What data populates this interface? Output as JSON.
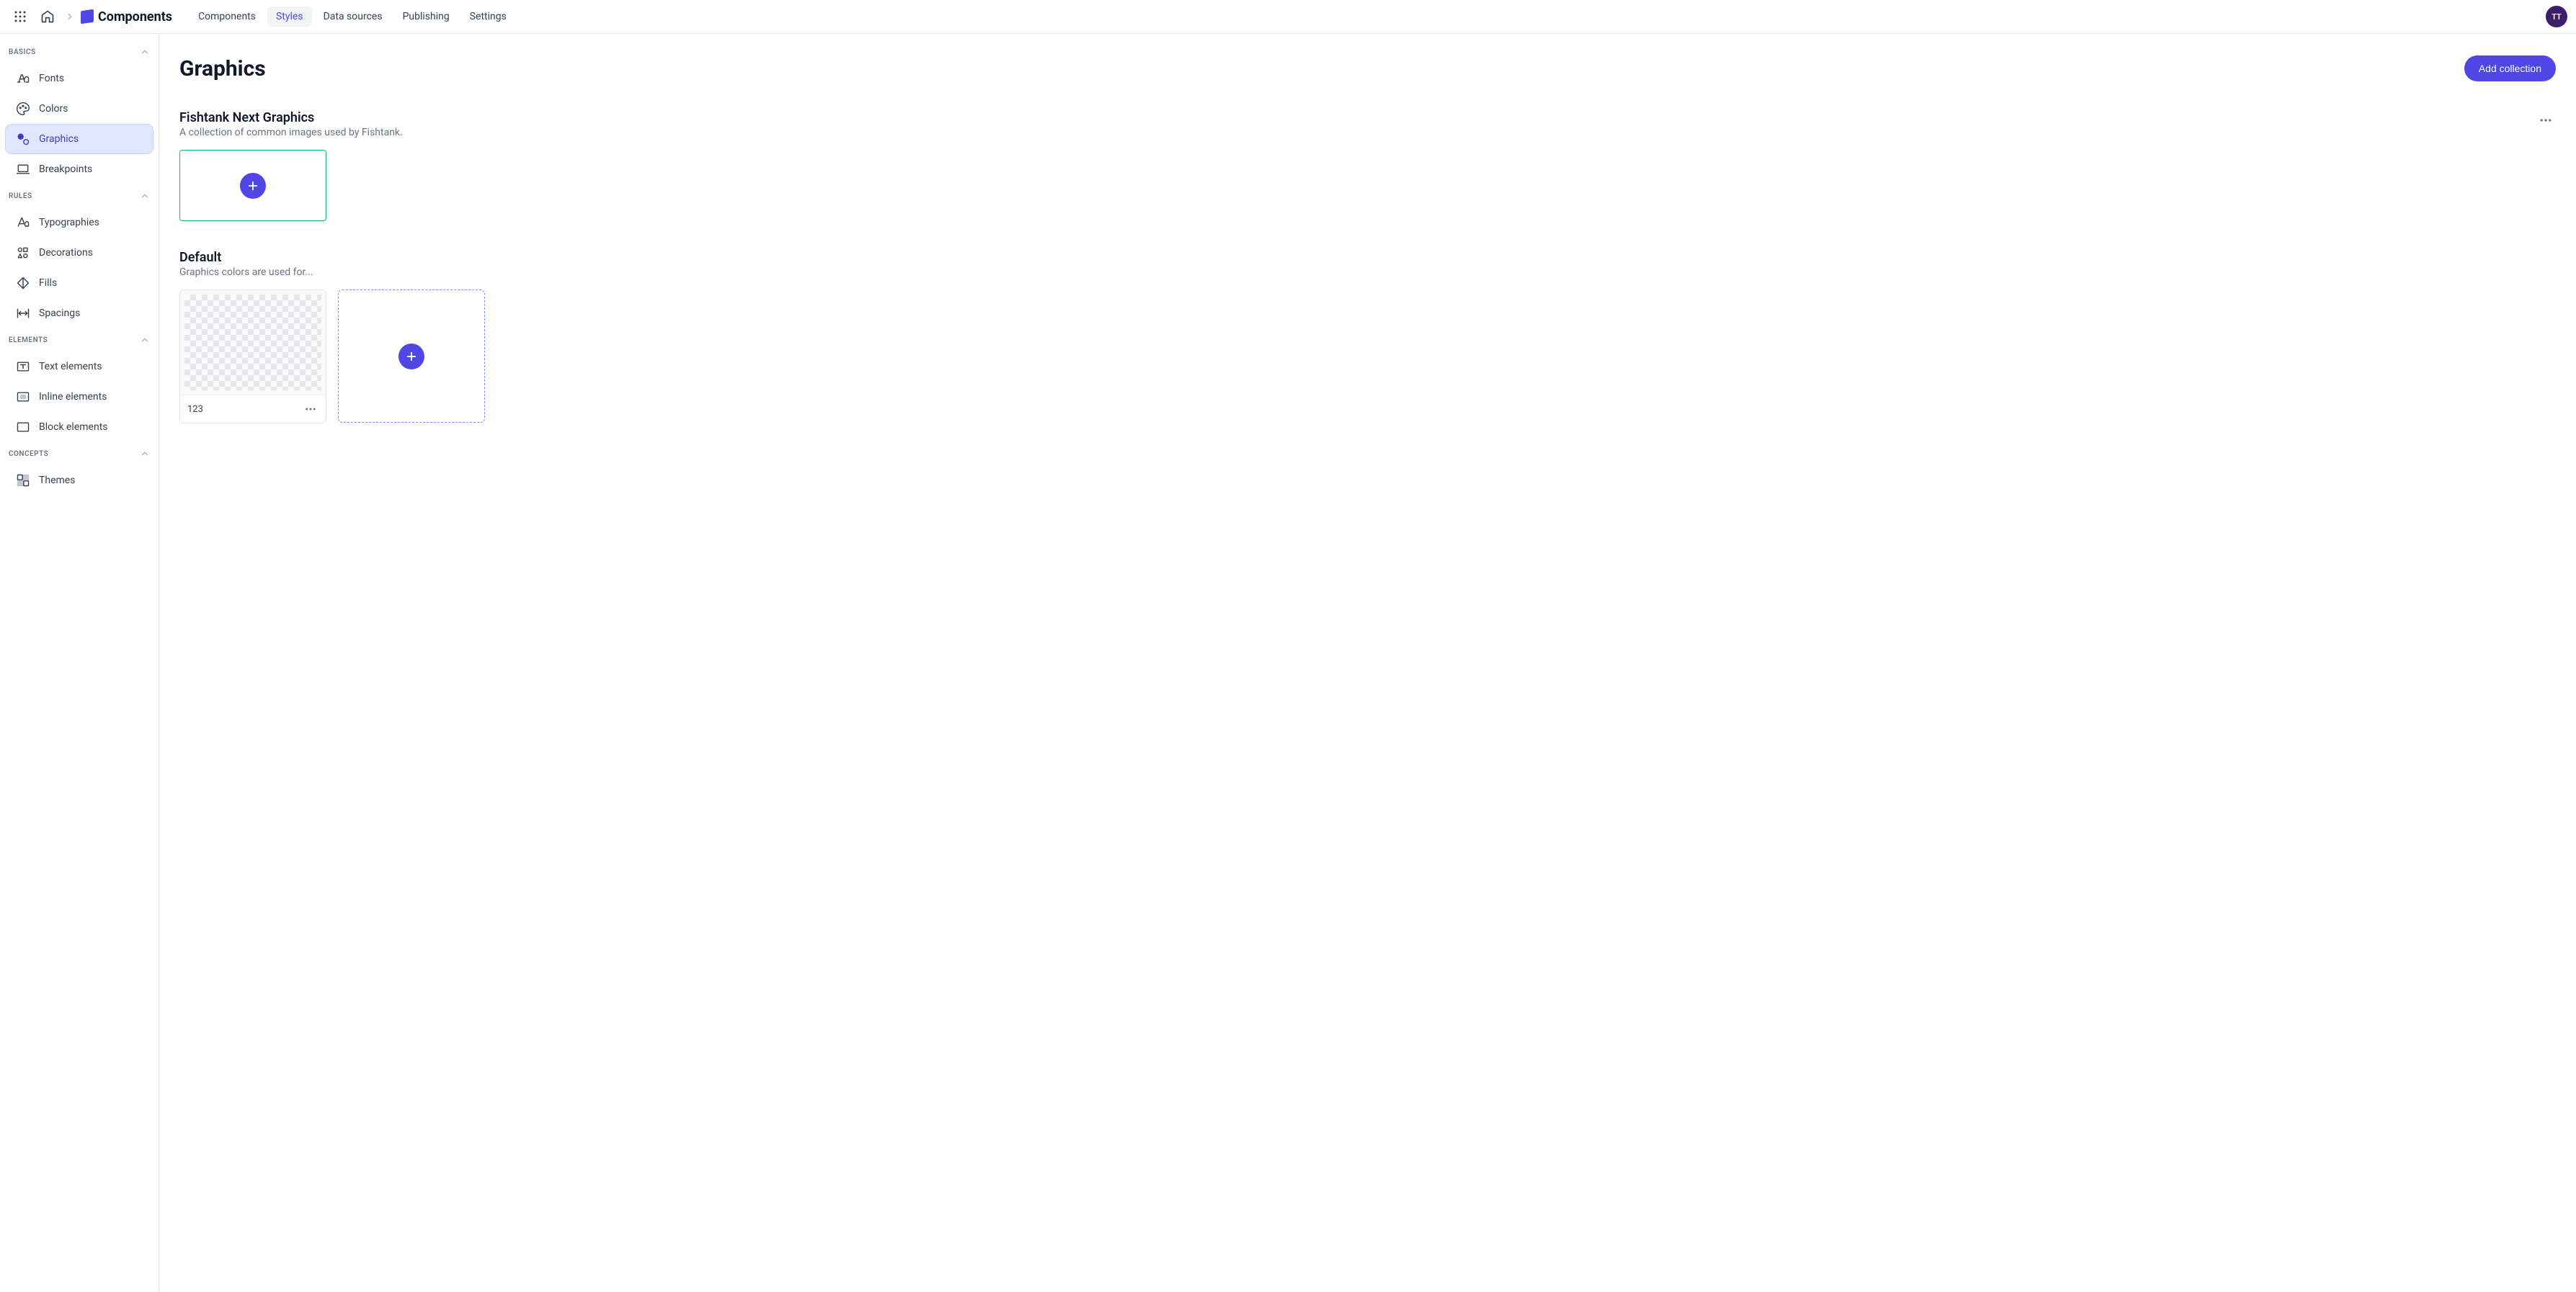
{
  "app": {
    "name": "Components",
    "avatar_initials": "TT"
  },
  "topnav": {
    "items": [
      {
        "label": "Components",
        "active": false
      },
      {
        "label": "Styles",
        "active": true
      },
      {
        "label": "Data sources",
        "active": false
      },
      {
        "label": "Publishing",
        "active": false
      },
      {
        "label": "Settings",
        "active": false
      }
    ]
  },
  "sidebar": {
    "sections": [
      {
        "title": "BASICS",
        "items": [
          {
            "label": "Fonts",
            "icon": "font-icon",
            "active": false
          },
          {
            "label": "Colors",
            "icon": "palette-icon",
            "active": false
          },
          {
            "label": "Graphics",
            "icon": "image-dot-icon",
            "active": true
          },
          {
            "label": "Breakpoints",
            "icon": "laptop-icon",
            "active": false
          }
        ]
      },
      {
        "title": "RULES",
        "items": [
          {
            "label": "Typographies",
            "icon": "typography-icon",
            "active": false
          },
          {
            "label": "Decorations",
            "icon": "shapes-icon",
            "active": false
          },
          {
            "label": "Fills",
            "icon": "diamond-icon",
            "active": false
          },
          {
            "label": "Spacings",
            "icon": "spacing-icon",
            "active": false
          }
        ]
      },
      {
        "title": "ELEMENTS",
        "items": [
          {
            "label": "Text elements",
            "icon": "text-box-icon",
            "active": false
          },
          {
            "label": "Inline elements",
            "icon": "inline-box-icon",
            "active": false
          },
          {
            "label": "Block elements",
            "icon": "block-box-icon",
            "active": false
          }
        ]
      },
      {
        "title": "CONCEPTS",
        "items": [
          {
            "label": "Themes",
            "icon": "themes-icon",
            "active": false
          }
        ]
      }
    ]
  },
  "page": {
    "title": "Graphics",
    "add_button_label": "Add collection",
    "collections": [
      {
        "title": "Fishtank Next Graphics",
        "description": "A collection of common images used by Fishtank.",
        "has_more_menu": true,
        "graphics": [],
        "add_button_kind": "solid-small"
      },
      {
        "title": "Default",
        "description": "Graphics colors are used for...",
        "has_more_menu": false,
        "graphics": [
          {
            "name": "123"
          }
        ],
        "add_button_kind": "dashed-large"
      }
    ]
  }
}
